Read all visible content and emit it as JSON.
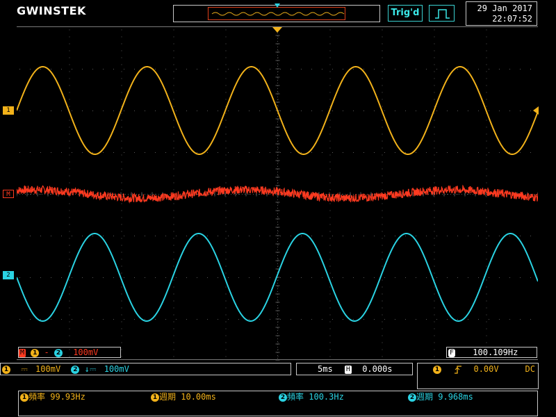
{
  "brand": {
    "logo": "GWINSTEK"
  },
  "status": {
    "trigger_state": "Trig'd",
    "date": "29 Jan 2017",
    "time": "22:07:52"
  },
  "colors": {
    "ch1": "#f2b21a",
    "ch2": "#2ad3e3",
    "math": "#ff3a20",
    "grid": "#5a5a5a",
    "frame": "#c8c8c8",
    "memory_window": "#e0401a"
  },
  "display": {
    "divisions_x": 10,
    "divisions_y": 8
  },
  "markers": {
    "ch1": "1",
    "math": "M",
    "ch2": "2"
  },
  "chart_data": {
    "type": "line",
    "x_unit": "ms",
    "y_unit": "div",
    "xlim": [
      -25,
      25
    ],
    "ylim": [
      -4,
      4
    ],
    "series": [
      {
        "name": "1",
        "wave": "sine",
        "frequency_hz": 99.93,
        "amplitude_div": 1.05,
        "offset_div": 2.0,
        "start_phase": "rising from zero",
        "color": "#f2b21a"
      },
      {
        "name": "M",
        "wave": "sine + noise",
        "frequency_hz": 50,
        "amplitude_div": 0.1,
        "noise_div": 0.1,
        "offset_div": 0.0,
        "color": "#ff3a20"
      },
      {
        "name": "2",
        "wave": "sine",
        "frequency_hz": 100.3,
        "amplitude_div": 1.05,
        "offset_div": -2.0,
        "start_phase": "falling from zero",
        "color": "#2ad3e3"
      }
    ]
  },
  "math_readout": {
    "operator": "-",
    "scale": "100mV"
  },
  "freq_counter": {
    "label": "F",
    "value": "100.109Hz"
  },
  "vertical": {
    "ch1_coupling": "⎓",
    "ch1_scale": "100mV",
    "ch2_coupling": "↓⎓",
    "ch2_scale": "100mV"
  },
  "horizontal": {
    "timebase": "5ms",
    "position_icon": "H",
    "position": "0.000s"
  },
  "trigger": {
    "source": "1",
    "slope_icon": "rising-edge",
    "level": "0.00V",
    "coupling": "DC"
  },
  "measurements": [
    {
      "channel": "1",
      "label": "頻率",
      "value": "99.93Hz"
    },
    {
      "channel": "1",
      "label": "週期",
      "value": "10.00ms"
    },
    {
      "channel": "2",
      "label": "頻率",
      "value": "100.3Hz"
    },
    {
      "channel": "2",
      "label": "週期",
      "value": "9.968ms"
    }
  ]
}
